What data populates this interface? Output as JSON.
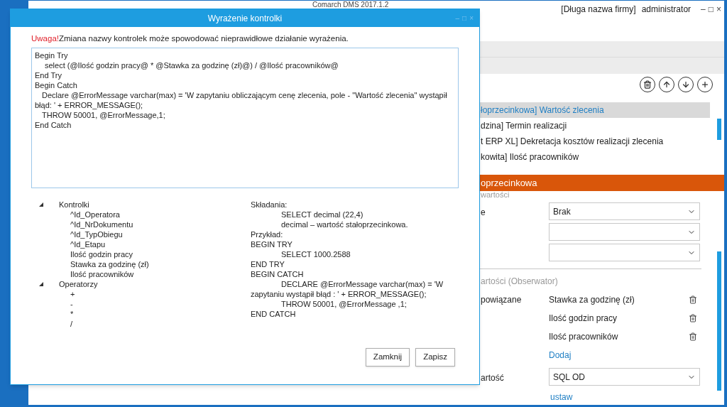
{
  "app": {
    "title": "Comarch DMS 2017.1.2",
    "company": "[Długa nazwa firmy]",
    "user": "administrator",
    "window_controls": [
      "–",
      "□",
      "×"
    ]
  },
  "list": {
    "items": [
      {
        "label": "łoprzecinkowa] Wartość zlecenia",
        "selected": true
      },
      {
        "label": "dzina] Termin realizacji",
        "selected": false
      },
      {
        "label": "t ERP XL] Dekretacja kosztów realizacji zlecenia",
        "selected": false
      },
      {
        "label": "kowita] Ilość pracowników",
        "selected": false
      }
    ]
  },
  "details": {
    "header": "oprzecinkowa",
    "subheader": "wartości",
    "fields": [
      {
        "kind": "select",
        "label": "e",
        "value": "Brak"
      },
      {
        "kind": "select"
      },
      {
        "kind": "select"
      }
    ]
  },
  "observer": {
    "title": "artości (Obserwator)",
    "label": "powiązane",
    "items": [
      "Stawka za godzinę (zł)",
      "Ilość godzin pracy",
      "Ilość pracowników"
    ],
    "add_link": "Dodaj"
  },
  "result": {
    "label": "artość",
    "value": "SQL OD",
    "link": "ustaw"
  },
  "dialog": {
    "title": "Wyrażenie kontrolki",
    "window_controls": [
      "–",
      "□",
      "×"
    ],
    "warning_prefix": "Uwaga!",
    "warning": "Zmiana nazwy kontrolek może spowodować nieprawidłowe działanie wyrażenia.",
    "code_lines": [
      {
        "kind": "plain",
        "text": "Begin Try"
      },
      {
        "kind": "deep",
        "text": "select (@Ilość godzin pracy@  *  @Stawka za godzinę (zł)@) / @Ilość pracowników@"
      },
      {
        "kind": "plain",
        "text": "End Try"
      },
      {
        "kind": "plain",
        "text": "Begin Catch"
      },
      {
        "kind": "indent",
        "text": "Declare @ErrorMessage varchar(max) = 'W zapytaniu obliczającym cenę zlecenia, pole - \"Wartość zlecenia\" wystąpił"
      },
      {
        "kind": "plain",
        "text": "błąd: ' + ERROR_MESSAGE();"
      },
      {
        "kind": "indent",
        "text": "THROW 50001, @ErrorMessage,1;"
      },
      {
        "kind": "plain",
        "text": "End Catch"
      }
    ],
    "tree": [
      {
        "label": "Kontrolki",
        "expanded": true,
        "children": [
          {
            "label": "^Id_Operatora"
          },
          {
            "label": "^Id_NrDokumentu"
          },
          {
            "label": "^Id_TypObiegu"
          },
          {
            "label": "^Id_Etapu"
          },
          {
            "label": "Ilość godzin pracy"
          },
          {
            "label": "Stawka za godzinę (zł)"
          },
          {
            "label": "Ilość pracowników"
          }
        ]
      },
      {
        "label": "Operatorzy",
        "expanded": true,
        "children": [
          {
            "label": "+"
          },
          {
            "label": "-"
          },
          {
            "label": "*"
          },
          {
            "label": "/"
          }
        ]
      }
    ],
    "help_lines": [
      {
        "kind": "plain",
        "text": "Składania:"
      },
      {
        "kind": "tab",
        "text": "SELECT decimal (22,4)"
      },
      {
        "kind": "tab",
        "text": "decimal – wartość stałoprzecinkowa."
      },
      {
        "kind": "plain",
        "text": "Przykład:"
      },
      {
        "kind": "plain",
        "text": "BEGIN TRY"
      },
      {
        "kind": "tab",
        "text": "SELECT 1000.2588"
      },
      {
        "kind": "plain",
        "text": "END TRY"
      },
      {
        "kind": "plain",
        "text": "BEGIN CATCH"
      },
      {
        "kind": "tab",
        "text": "DECLARE @ErrorMessage varchar(max) = 'W"
      },
      {
        "kind": "plain",
        "text": "zapytaniu wystąpił błąd : ' + ERROR_MESSAGE();"
      },
      {
        "kind": "tab",
        "text": "THROW 50001,  @ErrorMessage ,1;"
      },
      {
        "kind": "plain",
        "text": "END CATCH"
      }
    ],
    "buttons": [
      "Zamknij",
      "Zapisz"
    ]
  }
}
